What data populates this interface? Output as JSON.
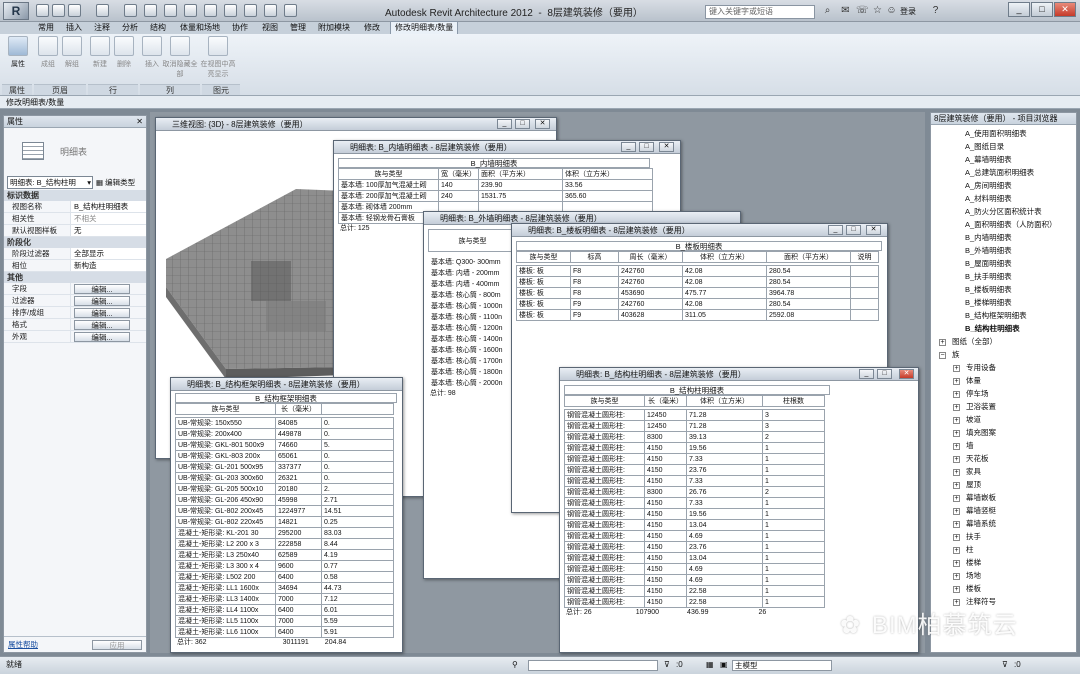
{
  "title": {
    "app": "Autodesk Revit Architecture 2012",
    "project": "8层建筑装修（要用）",
    "search_placeholder": "键入关键字或短语",
    "login": "登录"
  },
  "menu_tabs": [
    "常用",
    "插入",
    "注释",
    "分析",
    "结构",
    "体量和场地",
    "协作",
    "视图",
    "管理",
    "附加模块",
    "修改",
    "修改明细表/数量"
  ],
  "ribbon": {
    "buttons": [
      "属性",
      "成组",
      "解组",
      "新建",
      "删除",
      "插入",
      "取消隐藏全部",
      "在视图中高亮显示"
    ],
    "groups": [
      "属性",
      "页眉",
      "行",
      "列",
      "图元"
    ]
  },
  "context_label": "修改明细表/数量",
  "properties": {
    "header": "属性",
    "type_name": "明细表",
    "selector_value": "明细表: B_结构柱明",
    "edit_type": "编辑类型",
    "group_identity": "标识数据",
    "group_phase": "阶段化",
    "group_other": "其他",
    "rows_identity": [
      {
        "k": "视图名称",
        "v": "B_结构柱明细表"
      },
      {
        "k": "相关性",
        "v": "不相关"
      },
      {
        "k": "默认视图样板",
        "v": "无"
      }
    ],
    "rows_phase": [
      {
        "k": "阶段过滤器",
        "v": "全部显示"
      },
      {
        "k": "相位",
        "v": "新构造"
      }
    ],
    "rows_other": [
      "字段",
      "过滤器",
      "排序/成组",
      "格式",
      "外观"
    ],
    "edit_label": "编辑...",
    "help": "属性帮助",
    "apply": "应用"
  },
  "windows": {
    "view3d": "三维视图: {3D} - 8层建筑装修（要用）",
    "inner_wall": {
      "title": "明细表: B_内墙明细表 - 8层建筑装修（要用）",
      "header": "B_内墙明细表",
      "cols": [
        "族与类型",
        "宽（毫米）",
        "面积（平方米）",
        "体积（立方米）"
      ],
      "rows": [
        [
          "基本墙: 100厚加气混凝土砌",
          "140",
          "239.90",
          "33.56"
        ],
        [
          "基本墙: 200厚加气混凝土砌",
          "240",
          "1531.75",
          "365.60"
        ],
        [
          "基本墙: 砌体墙 200mm",
          "",
          "",
          ""
        ],
        [
          "基本墙: 轻钢龙骨石膏板",
          "",
          "",
          ""
        ]
      ],
      "total": "总计: 125"
    },
    "outer_wall": {
      "title": "明细表: B_外墙明细表 - 8层建筑装修（要用）",
      "col": "族与类型",
      "rows": [
        "基本墙: Q300- 300mm",
        "基本墙: 内墙 - 200mm",
        "基本墙: 内墙 - 400mm",
        "基本墙: 核心筒 - 800m",
        "基本墙: 核心筒 - 1000n",
        "基本墙: 核心筒 - 1100n",
        "基本墙: 核心筒 - 1200n",
        "基本墙: 核心筒 - 1400n",
        "基本墙: 核心筒 - 1600n",
        "基本墙: 核心筒 - 1700n",
        "基本墙: 核心筒 - 1800n",
        "基本墙: 核心筒 - 2000n"
      ],
      "total": "总计: 98"
    },
    "floor": {
      "title": "明细表: B_楼板明细表 - 8层建筑装修（要用）",
      "header": "B_楼板明细表",
      "cols": [
        "族与类型",
        "标高",
        "周长（毫米）",
        "体积（立方米）",
        "面积（平方米）",
        "说明"
      ],
      "rows": [
        [
          "楼板: 板",
          "F8",
          "242760",
          "42.08",
          "280.54",
          ""
        ],
        [
          "楼板: 板",
          "F8",
          "242760",
          "42.08",
          "280.54",
          ""
        ],
        [
          "楼板: 板",
          "F8",
          "453690",
          "475.77",
          "3964.78",
          ""
        ],
        [
          "楼板: 板",
          "F9",
          "242760",
          "42.08",
          "280.54",
          ""
        ],
        [
          "楼板: 板",
          "F9",
          "403628",
          "311.05",
          "2592.08",
          ""
        ]
      ]
    },
    "framing": {
      "title": "明细表: B_结构框架明细表 - 8层建筑装修（要用）",
      "header": "B_结构框架明细表",
      "cols": [
        "族与类型",
        "长（毫米）",
        ""
      ],
      "rows": [
        [
          "UB-常规梁: 150x550",
          "84085",
          "0."
        ],
        [
          "UB-常规梁: 200x400",
          "449878",
          "0."
        ],
        [
          "UB-常规梁: GKL-801 500x9",
          "74660",
          "5."
        ],
        [
          "UB-常规梁: GKL-803 200x",
          "65061",
          "0."
        ],
        [
          "UB-常规梁: GL-201 500x95",
          "337377",
          "0."
        ],
        [
          "UB-常规梁: GL-203 300x60",
          "26321",
          "0."
        ],
        [
          "UB-常规梁: GL-205 500x10",
          "20180",
          "2."
        ],
        [
          "UB-常规梁: GL-206 450x90",
          "45998",
          "2.71"
        ],
        [
          "UB-常规梁: GL-802 200x45",
          "1224977",
          "14.51"
        ],
        [
          "UB-常规梁: GL-802 220x45",
          "14821",
          "0.25"
        ],
        [
          "混凝土-矩形梁: KL-201 30",
          "295200",
          "83.03"
        ],
        [
          "混凝土-矩形梁: L2 200 x 3",
          "222858",
          "8.44"
        ],
        [
          "混凝土-矩形梁: L3 250x40",
          "62589",
          "4.19"
        ],
        [
          "混凝土-矩形梁: L3 300 x 4",
          "9600",
          "0.77"
        ],
        [
          "混凝土-矩形梁: L502 200",
          "6400",
          "0.58"
        ],
        [
          "混凝土-矩形梁: LL1 1600x",
          "34694",
          "44.73"
        ],
        [
          "混凝土-矩形梁: LL3 1400x",
          "7000",
          "7.12"
        ],
        [
          "混凝土-矩形梁: LL4 1100x",
          "6400",
          "6.01"
        ],
        [
          "混凝土-矩形梁: LL5 1100x",
          "7000",
          "5.59"
        ],
        [
          "混凝土-矩形梁: LL6 1100x",
          "6400",
          "5.91"
        ]
      ],
      "total_label": "总计: 362",
      "total_len": "3011191",
      "total_vol": "204.84"
    },
    "column": {
      "title": "明细表: B_结构柱明细表 - 8层建筑装修（要用）",
      "header": "B_结构柱明细表",
      "cols": [
        "族与类型",
        "长（毫米）",
        "体积（立方米）",
        "柱根数"
      ],
      "rows": [
        [
          "钢管混凝土圆形柱:",
          "12450",
          "71.28",
          "3"
        ],
        [
          "钢管混凝土圆形柱:",
          "12450",
          "71.28",
          "3"
        ],
        [
          "钢管混凝土圆形柱:",
          "8300",
          "39.13",
          "2"
        ],
        [
          "钢管混凝土圆形柱:",
          "4150",
          "19.56",
          "1"
        ],
        [
          "钢管混凝土圆形柱:",
          "4150",
          "7.33",
          "1"
        ],
        [
          "钢管混凝土圆形柱:",
          "4150",
          "23.76",
          "1"
        ],
        [
          "钢管混凝土圆形柱:",
          "4150",
          "7.33",
          "1"
        ],
        [
          "钢管混凝土圆形柱:",
          "8300",
          "26.76",
          "2"
        ],
        [
          "钢管混凝土圆形柱:",
          "4150",
          "7.33",
          "1"
        ],
        [
          "钢管混凝土圆形柱:",
          "4150",
          "19.56",
          "1"
        ],
        [
          "钢管混凝土圆形柱:",
          "4150",
          "13.04",
          "1"
        ],
        [
          "钢管混凝土圆形柱:",
          "4150",
          "4.69",
          "1"
        ],
        [
          "钢管混凝土圆形柱:",
          "4150",
          "23.76",
          "1"
        ],
        [
          "钢管混凝土圆形柱:",
          "4150",
          "13.04",
          "1"
        ],
        [
          "钢管混凝土圆形柱:",
          "4150",
          "4.69",
          "1"
        ],
        [
          "钢管混凝土圆形柱:",
          "4150",
          "4.69",
          "1"
        ],
        [
          "钢管混凝土圆形柱:",
          "4150",
          "22.58",
          "1"
        ],
        [
          "钢管混凝土圆形柱:",
          "4150",
          "22.58",
          "1"
        ]
      ],
      "total_label": "总计: 26",
      "total_len": "107900",
      "total_vol": "436.99",
      "total_count": "26"
    }
  },
  "browser": {
    "title": "8层建筑装修（要用） - 项目浏览器",
    "schedules": [
      "A_使用面积明细表",
      "A_图纸目录",
      "A_幕墙明细表",
      "A_总建筑面积明细表",
      "A_房间明细表",
      "A_材料明细表",
      "A_防火分区面积统计表",
      "A_面积明细表（人防面积）",
      "B_内墙明细表",
      "B_外墙明细表",
      "B_屋面明细表",
      "B_扶手明细表",
      "B_楼板明细表",
      "B_楼梯明细表",
      "B_结构框架明细表",
      "B_结构柱明细表"
    ],
    "sheets": "图纸（全部）",
    "families": "族",
    "family_items": [
      "专用设备",
      "体量",
      "停车场",
      "卫浴装置",
      "坡道",
      "填充图案",
      "墙",
      "天花板",
      "家具",
      "屋顶",
      "幕墙嵌板",
      "幕墙竖梃",
      "幕墙系统",
      "扶手",
      "柱",
      "楼梯",
      "场地",
      "楼板",
      "注释符号"
    ]
  },
  "status": {
    "left": "就绪",
    "count": ":0",
    "model": "主模型",
    "filter": ":0"
  },
  "watermark": "BIM柏慕筑云"
}
